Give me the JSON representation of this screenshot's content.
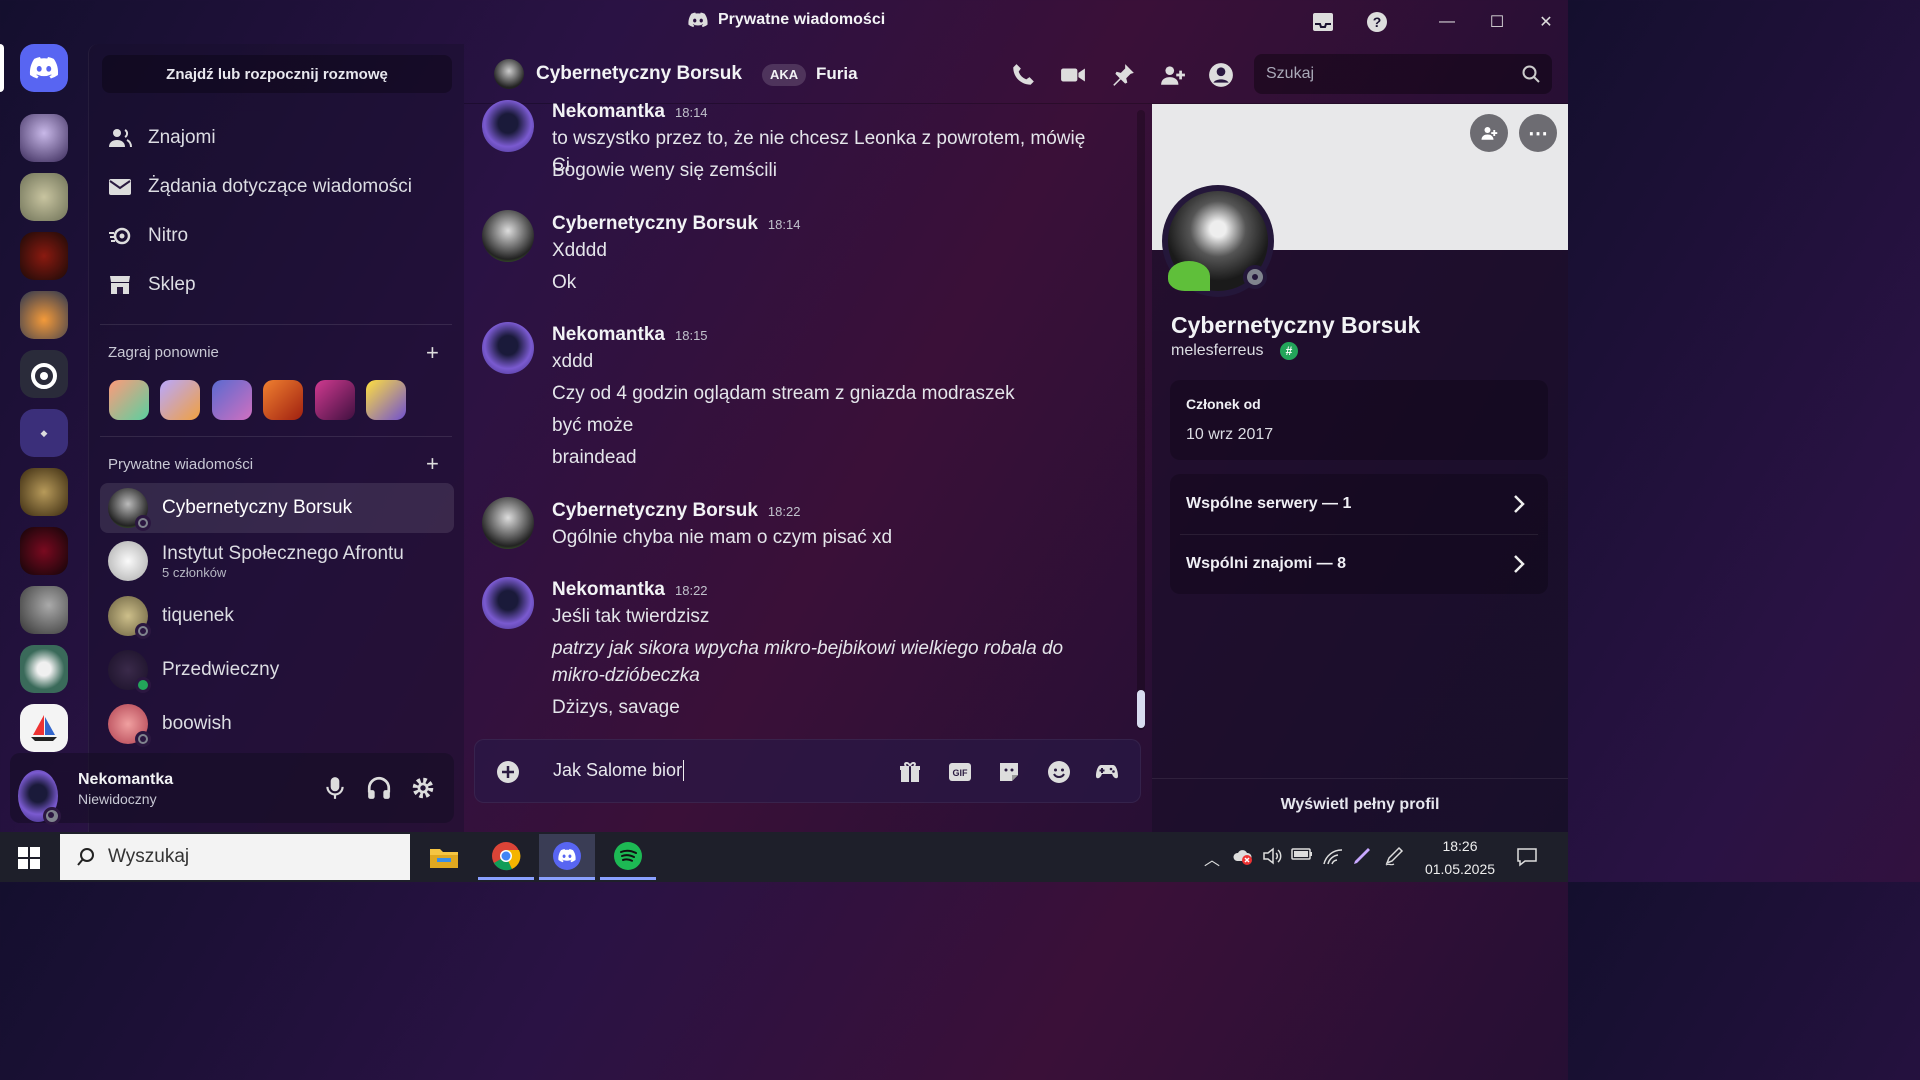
{
  "window": {
    "title": "Prywatne wiadomości"
  },
  "sidebar": {
    "find_button": "Znajdź lub rozpocznij rozmowę",
    "nav": [
      {
        "label": "Znajomi",
        "icon": "friends-icon"
      },
      {
        "label": "Żądania dotyczące wiadomości",
        "icon": "mail-icon"
      },
      {
        "label": "Nitro",
        "icon": "nitro-icon"
      },
      {
        "label": "Sklep",
        "icon": "shop-icon"
      }
    ],
    "play_again_header": "Zagraj ponownie",
    "dm_header": "Prywatne wiadomości",
    "dms": [
      {
        "name": "Cybernetyczny Borsuk",
        "sub": "",
        "status": "offline"
      },
      {
        "name": "Instytut Społecznego Afrontu",
        "sub": "5 członków",
        "status": ""
      },
      {
        "name": "tiquenek",
        "sub": "",
        "status": "offline"
      },
      {
        "name": "Przedwieczny",
        "sub": "",
        "status": "online"
      },
      {
        "name": "boowish",
        "sub": "",
        "status": "offline"
      }
    ]
  },
  "user_panel": {
    "name": "Nekomantka",
    "status": "Niewidoczny"
  },
  "chat_header": {
    "name": "Cybernetyczny Borsuk",
    "aka_badge": "AKA",
    "aka_name": "Furia",
    "search_placeholder": "Szukaj"
  },
  "messages": [
    {
      "author": "Nekomantka",
      "time": "18:14",
      "lines": [
        "to wszystko przez to, że nie chcesz Leonka z powrotem, mówię Ci",
        "Bogowie weny się zemścili"
      ]
    },
    {
      "author": "Cybernetyczny Borsuk",
      "time": "18:14",
      "lines": [
        "Xdddd",
        "Ok"
      ]
    },
    {
      "author": "Nekomantka",
      "time": "18:15",
      "lines": [
        "xddd",
        "Czy od 4 godzin oglądam stream z gniazda modraszek",
        "być może",
        "braindead"
      ]
    },
    {
      "author": "Cybernetyczny Borsuk",
      "time": "18:22",
      "lines": [
        "Ogólnie chyba nie mam o czym pisać xd"
      ]
    },
    {
      "author": "Nekomantka",
      "time": "18:22",
      "lines": [
        "Jeśli tak twierdzisz",
        "patrzy jak sikora wpycha mikro-bejbikowi wielkiego robala do mikro-dzióbeczka",
        "Dżizys, savage"
      ]
    }
  ],
  "composer": {
    "value": "Jak Salome bior"
  },
  "profile": {
    "display_name": "Cybernetyczny Borsuk",
    "username": "melesferreus",
    "member_since_label": "Członek od",
    "member_since": "10 wrz 2017",
    "mutual_servers": "Wspólne serwery — 1",
    "mutual_friends": "Wspólni znajomi — 8",
    "full_profile": "Wyświetl pełny profil"
  },
  "taskbar": {
    "search": "Wyszukaj",
    "time": "18:26",
    "date": "01.05.2025"
  },
  "colors": {
    "accent": "#5865f2",
    "online": "#23a55a",
    "offline": "#80848e",
    "discord": "#5865f2",
    "spotify": "#1db954"
  }
}
